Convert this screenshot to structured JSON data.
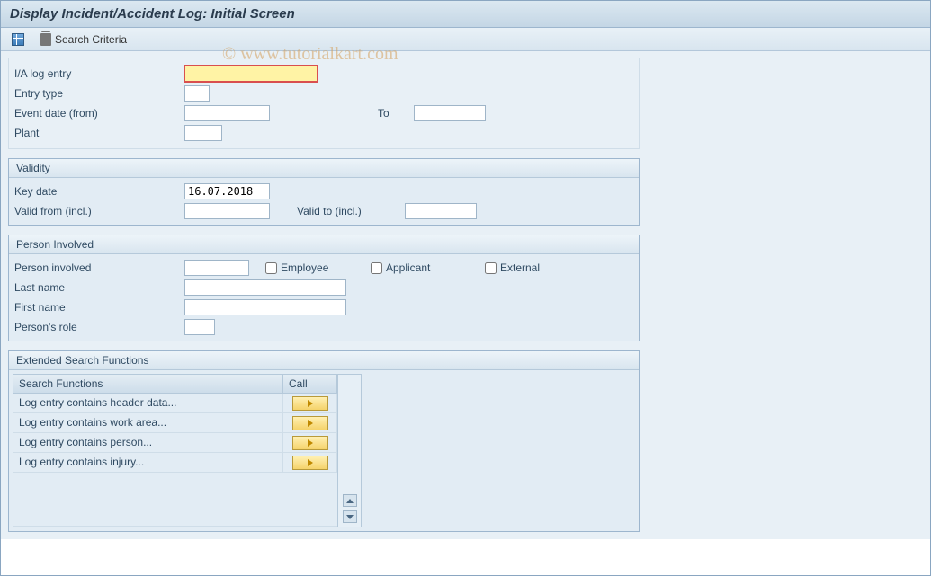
{
  "title": "Display Incident/Accident Log: Initial Screen",
  "toolbar": {
    "search_criteria": "Search Criteria"
  },
  "watermark": "© www.tutorialkart.com",
  "fields": {
    "ia_log_entry": {
      "label": "I/A log entry",
      "value": ""
    },
    "entry_type": {
      "label": "Entry type",
      "value": ""
    },
    "event_date_from": {
      "label": "Event date (from)",
      "value": ""
    },
    "to_label": "To",
    "event_date_to": "",
    "plant": {
      "label": "Plant",
      "value": ""
    }
  },
  "validity": {
    "title": "Validity",
    "key_date": {
      "label": "Key date",
      "value": "16.07.2018"
    },
    "valid_from": {
      "label": "Valid from (incl.)",
      "value": ""
    },
    "valid_to_label": "Valid to (incl.)",
    "valid_to": ""
  },
  "person": {
    "title": "Person Involved",
    "person_involved": {
      "label": "Person involved",
      "value": ""
    },
    "employee_label": "Employee",
    "applicant_label": "Applicant",
    "external_label": "External",
    "last_name": {
      "label": "Last name",
      "value": ""
    },
    "first_name": {
      "label": "First name",
      "value": ""
    },
    "persons_role": {
      "label": "Person's role",
      "value": ""
    }
  },
  "extended": {
    "title": "Extended Search Functions",
    "col_func": "Search Functions",
    "col_call": "Call",
    "rows": [
      "Log entry contains header data...",
      "Log entry contains work area...",
      "Log entry contains person...",
      "Log entry contains injury..."
    ]
  }
}
